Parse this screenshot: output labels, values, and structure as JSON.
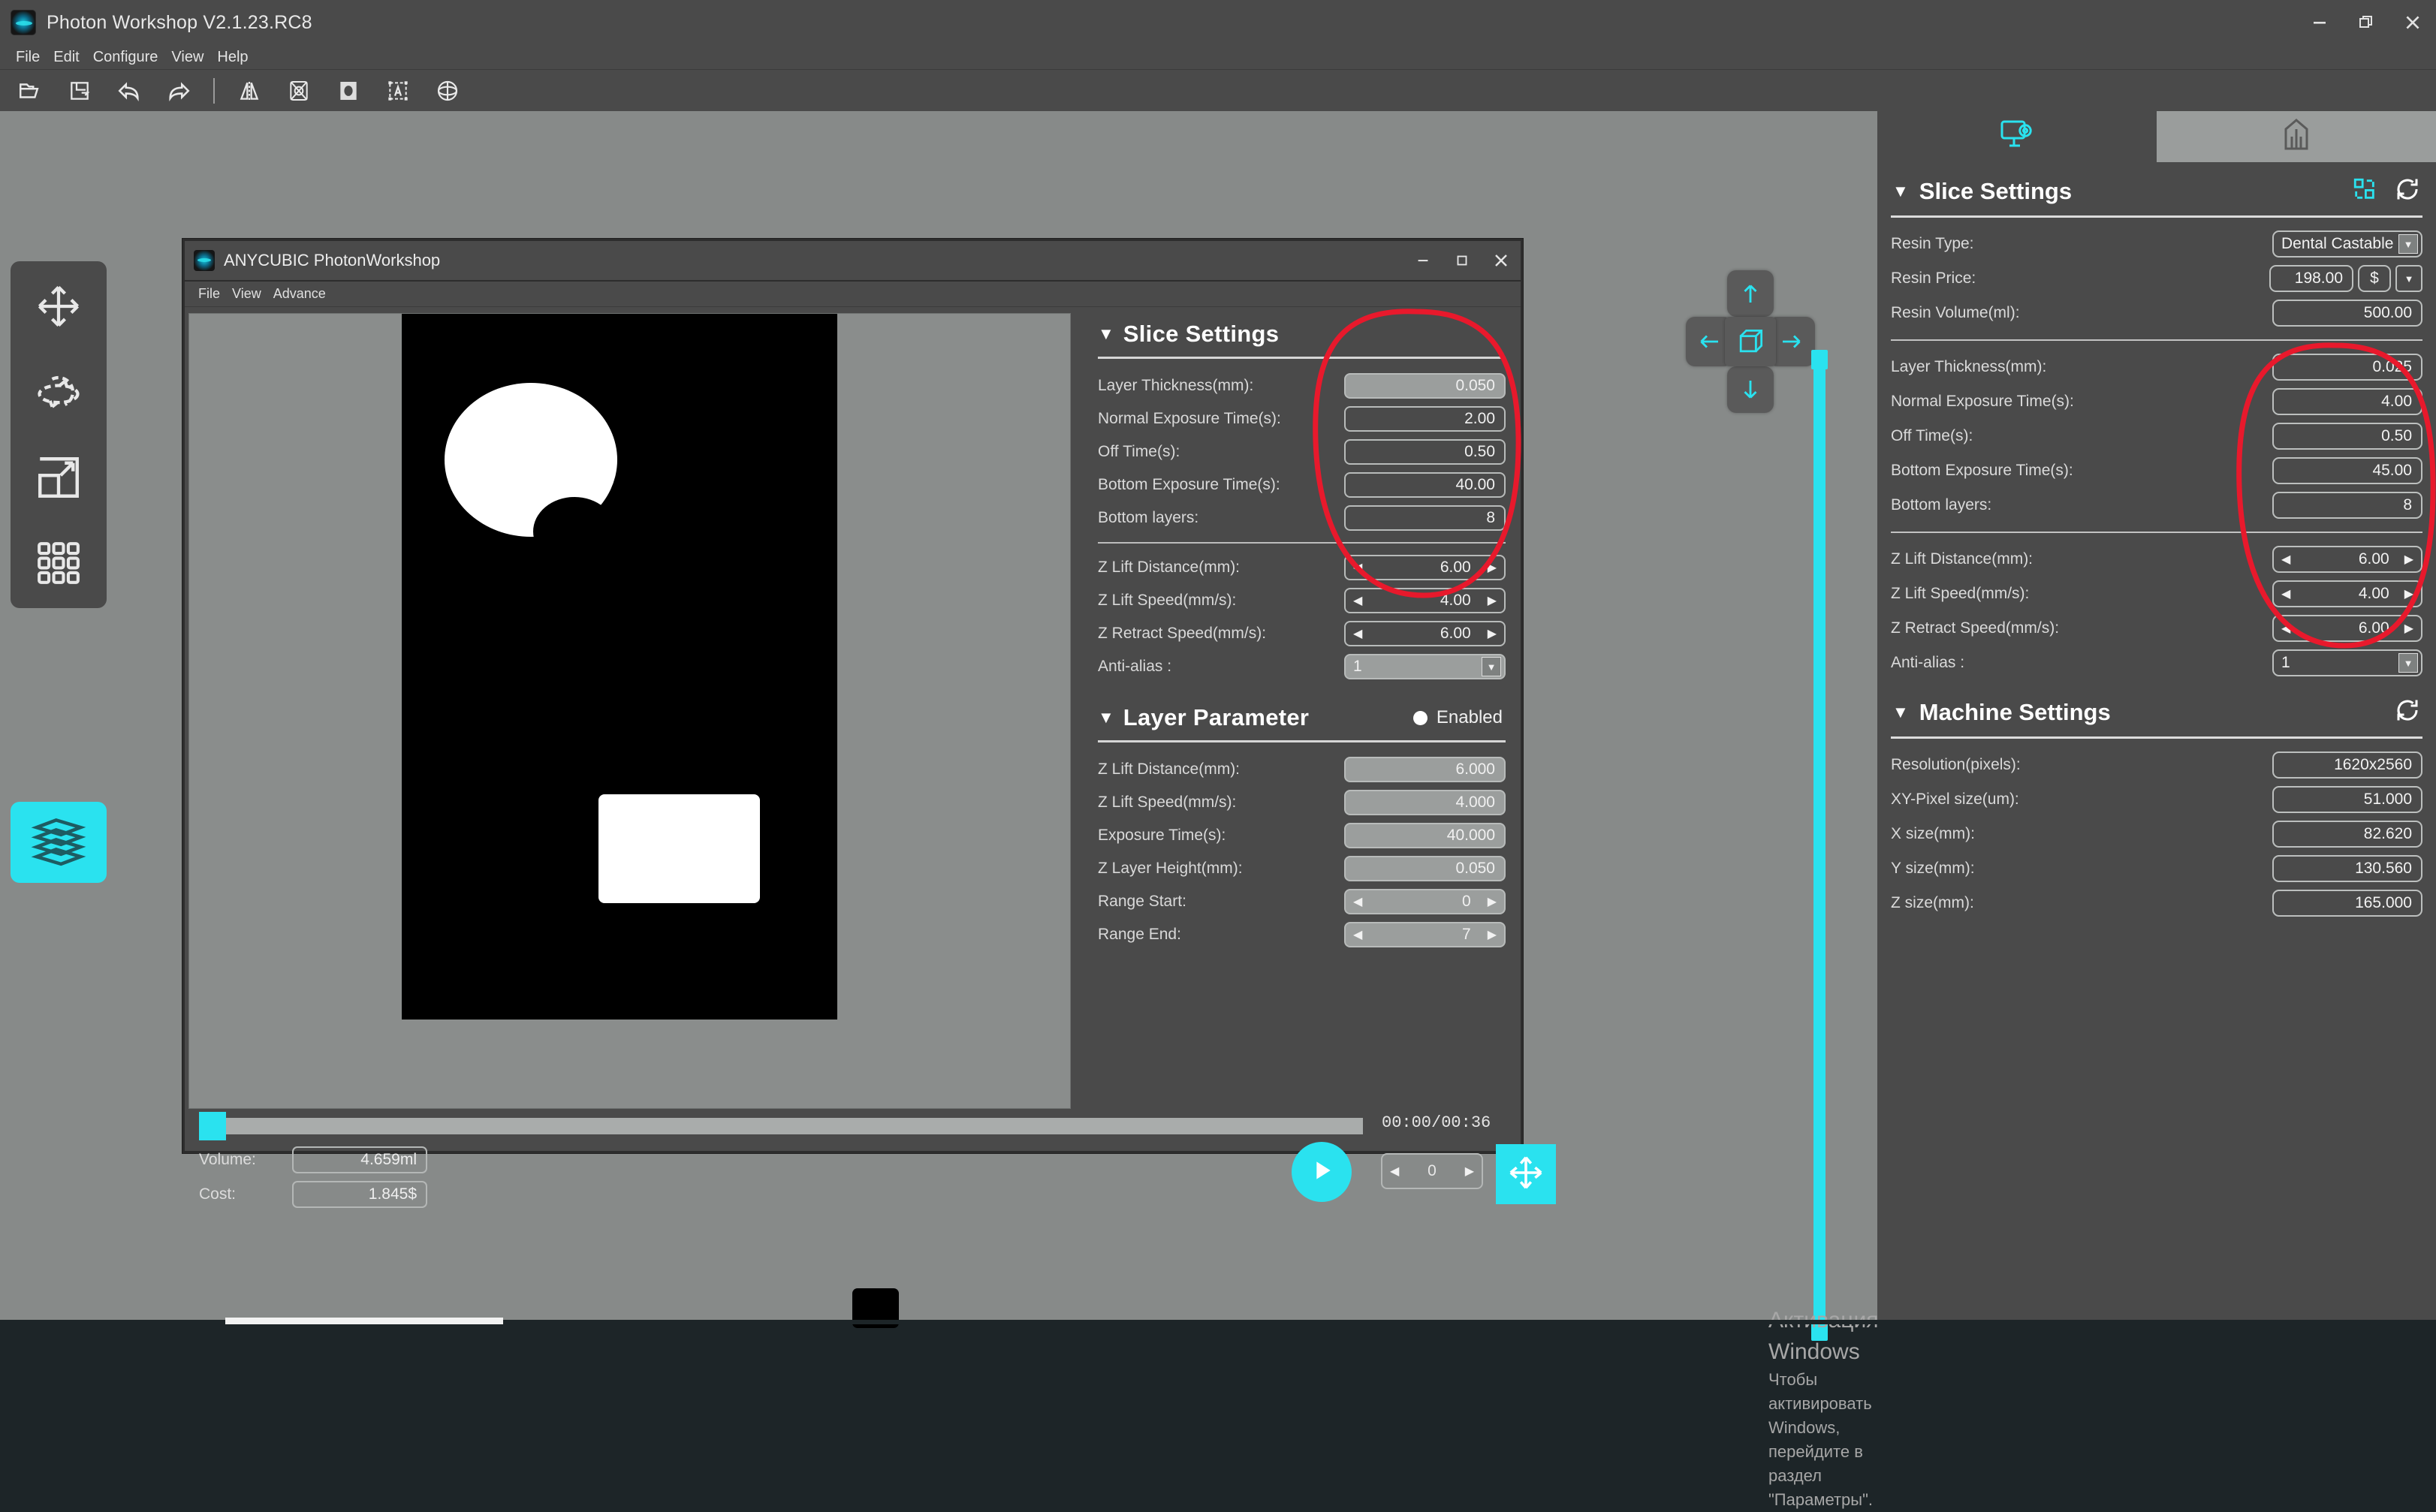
{
  "window": {
    "title": "Photon Workshop V2.1.23.RC8",
    "logo_icon": "photon-app-logo",
    "controls": {
      "minimize": "minimize-icon",
      "restore": "restore-icon",
      "close": "close-icon"
    }
  },
  "menubar": {
    "items": [
      "File",
      "Edit",
      "Configure",
      "View",
      "Help"
    ]
  },
  "toolbar": {
    "buttons": [
      {
        "name": "open-file",
        "icon": "folder-open-icon"
      },
      {
        "name": "save-file",
        "icon": "save-disk-icon"
      },
      {
        "name": "undo",
        "icon": "undo-arrow-icon"
      },
      {
        "name": "redo",
        "icon": "redo-arrow-icon"
      },
      {
        "name": "mirror",
        "icon": "mirror-icon"
      },
      {
        "name": "hollow",
        "icon": "hollow-mesh-icon"
      },
      {
        "name": "punch-hole",
        "icon": "punch-hole-icon"
      },
      {
        "name": "add-text",
        "icon": "text-label-icon"
      },
      {
        "name": "sphere-tool",
        "icon": "sphere-slice-icon"
      }
    ]
  },
  "left_rail": {
    "buttons": [
      {
        "name": "move-tool",
        "icon": "move-arrows-icon"
      },
      {
        "name": "rotate-tool",
        "icon": "rotate-orbit-icon"
      },
      {
        "name": "scale-tool",
        "icon": "scale-expand-icon"
      },
      {
        "name": "array-tool",
        "icon": "grid-array-icon"
      }
    ],
    "active_button": {
      "name": "slice-layers-tool",
      "icon": "layers-stack-icon"
    }
  },
  "gizmo": {
    "up": "arrow-up-icon",
    "down": "arrow-down-icon",
    "left": "arrow-left-icon",
    "right": "arrow-right-icon",
    "center": "cube-home-icon"
  },
  "watermark": {
    "line1": "Активация Windows",
    "line2": "Чтобы активировать Windows, перейдите в раздел \"Параметры\"."
  },
  "dialog": {
    "title": "ANYCUBIC PhotonWorkshop",
    "logo_icon": "anycubic-logo",
    "menu": [
      "File",
      "View",
      "Advance"
    ],
    "controls": {
      "minimize": "minimize-icon",
      "maximize": "maximize-icon",
      "close": "close-icon"
    },
    "preview": {
      "name": "slice-preview-image",
      "shapes": [
        "ring",
        "rounded-card"
      ]
    },
    "timeline": {
      "time": "00:00/00:36",
      "progress_percent": 2
    },
    "volume": {
      "label": "Volume:",
      "value": "4.659ml"
    },
    "cost": {
      "label": "Cost:",
      "value": "1.845$"
    },
    "play_button": {
      "name": "play-button",
      "icon": "play-triangle-icon"
    },
    "frame_spinner": {
      "value": "0"
    },
    "fit_button": {
      "name": "fit-view-button",
      "icon": "fit-arrows-icon"
    },
    "slice_settings": {
      "title": "Slice Settings",
      "caret": "▼",
      "rows": [
        {
          "label": "Layer Thickness(mm):",
          "value": "0.050",
          "kind": "text",
          "highlight": true
        },
        {
          "label": "Normal Exposure Time(s):",
          "value": "2.00",
          "kind": "text"
        },
        {
          "label": "Off Time(s):",
          "value": "0.50",
          "kind": "text"
        },
        {
          "label": "Bottom Exposure Time(s):",
          "value": "40.00",
          "kind": "text"
        },
        {
          "label": "Bottom layers:",
          "value": "8",
          "kind": "text"
        }
      ],
      "rows2": [
        {
          "label": "Z Lift Distance(mm):",
          "value": "6.00",
          "kind": "spin"
        },
        {
          "label": "Z Lift Speed(mm/s):",
          "value": "4.00",
          "kind": "spin"
        },
        {
          "label": "Z Retract Speed(mm/s):",
          "value": "6.00",
          "kind": "spin"
        },
        {
          "label": "Anti-alias :",
          "value": "1",
          "kind": "combo"
        }
      ]
    },
    "layer_parameter": {
      "title": "Layer Parameter",
      "caret": "▼",
      "enabled_label": "Enabled",
      "enabled": true,
      "rows": [
        {
          "label": "Z Lift Distance(mm):",
          "value": "6.000",
          "kind": "text"
        },
        {
          "label": "Z Lift Speed(mm/s):",
          "value": "4.000",
          "kind": "text"
        },
        {
          "label": "Exposure Time(s):",
          "value": "40.000",
          "kind": "text"
        },
        {
          "label": "Z Layer Height(mm):",
          "value": "0.050",
          "kind": "text"
        },
        {
          "label": "Range Start:",
          "value": "0",
          "kind": "spin"
        },
        {
          "label": "Range End:",
          "value": "7",
          "kind": "spin"
        }
      ]
    }
  },
  "right_panel": {
    "tabs": [
      {
        "name": "tab-slice-settings",
        "icon": "monitor-gear-icon",
        "selected": true
      },
      {
        "name": "tab-machine",
        "icon": "printer-outline-icon",
        "selected": false
      }
    ],
    "slice_settings": {
      "title": "Slice Settings",
      "caret": "▼",
      "actions": [
        {
          "name": "duplicate-profile-button",
          "icon": "copy-blocks-icon"
        },
        {
          "name": "reset-slice-settings-button",
          "icon": "refresh-circle-icon"
        }
      ],
      "group1": [
        {
          "label": "Resin Type:",
          "value": "Dental Castable",
          "kind": "combo"
        },
        {
          "label": "Resin Price:",
          "value": "198.00",
          "currency": "$",
          "kind": "price"
        },
        {
          "label": "Resin Volume(ml):",
          "value": "500.00",
          "kind": "text"
        }
      ],
      "group2": [
        {
          "label": "Layer Thickness(mm):",
          "value": "0.025",
          "kind": "text"
        },
        {
          "label": "Normal Exposure Time(s):",
          "value": "4.00",
          "kind": "text"
        },
        {
          "label": "Off Time(s):",
          "value": "0.50",
          "kind": "text"
        },
        {
          "label": "Bottom Exposure Time(s):",
          "value": "45.00",
          "kind": "text"
        },
        {
          "label": "Bottom layers:",
          "value": "8",
          "kind": "text"
        }
      ],
      "group3": [
        {
          "label": "Z Lift Distance(mm):",
          "value": "6.00",
          "kind": "spin"
        },
        {
          "label": "Z Lift Speed(mm/s):",
          "value": "4.00",
          "kind": "spin"
        },
        {
          "label": "Z Retract Speed(mm/s):",
          "value": "6.00",
          "kind": "spin"
        },
        {
          "label": "Anti-alias :",
          "value": "1",
          "kind": "combo"
        }
      ]
    },
    "machine_settings": {
      "title": "Machine Settings",
      "caret": "▼",
      "actions": [
        {
          "name": "reset-machine-settings-button",
          "icon": "refresh-circle-icon"
        }
      ],
      "rows": [
        {
          "label": "Resolution(pixels):",
          "value": "1620x2560"
        },
        {
          "label": "XY-Pixel size(um):",
          "value": "51.000"
        },
        {
          "label": "X size(mm):",
          "value": "82.620"
        },
        {
          "label": "Y size(mm):",
          "value": "130.560"
        },
        {
          "label": "Z size(mm):",
          "value": "165.000"
        }
      ]
    }
  },
  "annotations": [
    {
      "name": "red-ellipse-inner-dialog",
      "color": "#e8192c",
      "target": "inner slice settings values"
    },
    {
      "name": "red-ellipse-right-panel",
      "color": "#e8192c",
      "target": "right panel slice settings values"
    }
  ],
  "colors": {
    "accent_cyan": "#2ae2ef",
    "panel_bg": "#4a4a4a",
    "viewport_bg": "#878a89",
    "annotation_red": "#e8192c"
  }
}
